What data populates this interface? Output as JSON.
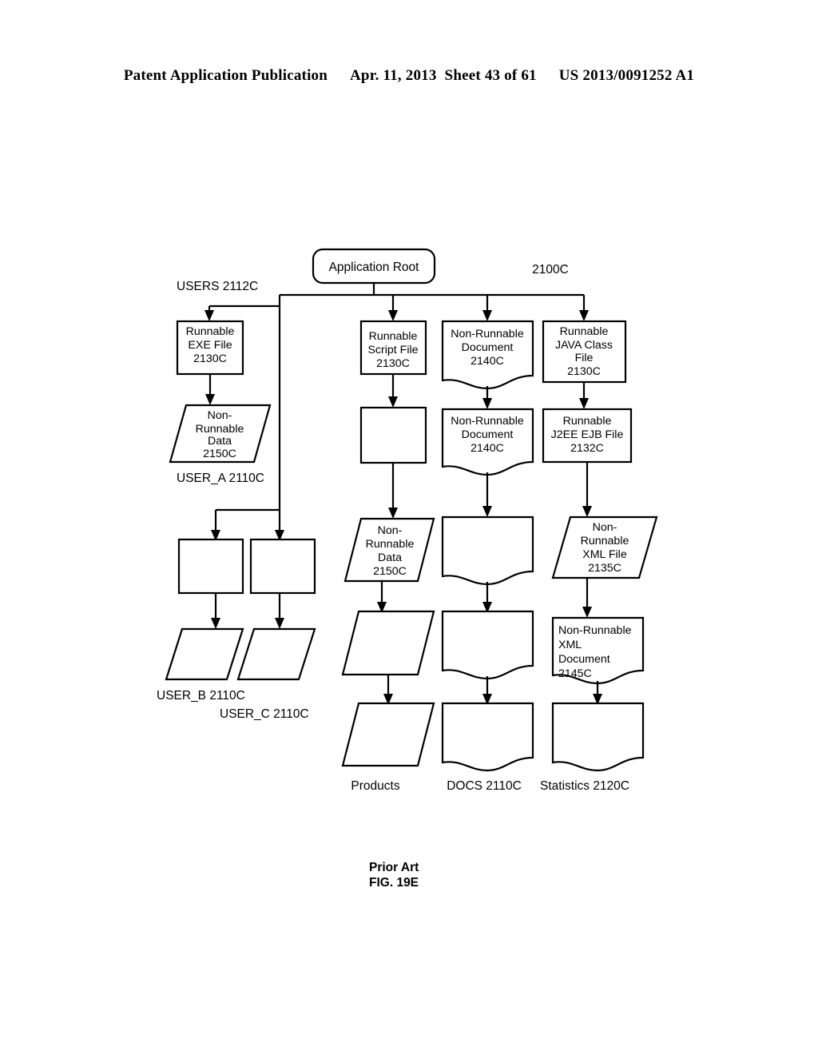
{
  "header": {
    "publication": "Patent Application Publication",
    "date": "Apr. 11, 2013",
    "sheet": "Sheet 43 of 61",
    "number": "US 2013/0091252 A1"
  },
  "caption": {
    "prior_art": "Prior Art",
    "figure": "FIG. 19E"
  },
  "diagram": {
    "root_label": "Application Root",
    "diagram_ref": "2100C",
    "users_label": "USERS 2112C",
    "user_a_label": "USER_A 2110C",
    "user_b_label": "USER_B 2110C",
    "user_c_label": "USER_C 2110C",
    "products_label": "Products",
    "docs_label": "DOCS 2110C",
    "statistics_label": "Statistics 2120C",
    "nodes": {
      "exe_file": {
        "lines": [
          "Runnable",
          "EXE File",
          "2130C"
        ],
        "shape": "rect"
      },
      "nonrunnable_data_a": {
        "lines": [
          "Non-",
          "Runnable",
          "Data",
          "2150C"
        ],
        "shape": "parallelogram"
      },
      "user_b_box": {
        "lines": [],
        "shape": "rect"
      },
      "user_c_box": {
        "lines": [],
        "shape": "rect"
      },
      "user_b_data": {
        "lines": [],
        "shape": "parallelogram"
      },
      "user_c_data": {
        "lines": [],
        "shape": "parallelogram"
      },
      "script_file": {
        "lines": [
          "Runnable",
          "Script File",
          "2130C"
        ],
        "shape": "rect"
      },
      "script_child_box": {
        "lines": [],
        "shape": "rect"
      },
      "script_data": {
        "lines": [
          "Non-",
          "Runnable",
          "Data",
          "2150C"
        ],
        "shape": "parallelogram"
      },
      "products_mid": {
        "lines": [],
        "shape": "parallelogram"
      },
      "products_bottom": {
        "lines": [],
        "shape": "parallelogram"
      },
      "document_top": {
        "lines": [
          "Non-Runnable",
          "Document",
          "2140C"
        ],
        "shape": "document"
      },
      "document_second": {
        "lines": [
          "Non-Runnable",
          "Document",
          "2140C"
        ],
        "shape": "document"
      },
      "document_third": {
        "lines": [],
        "shape": "document"
      },
      "document_fourth": {
        "lines": [],
        "shape": "document"
      },
      "document_bottom": {
        "lines": [],
        "shape": "document"
      },
      "java_class_file": {
        "lines": [
          "Runnable",
          "JAVA Class",
          "File",
          "2130C"
        ],
        "shape": "rect"
      },
      "j2ee_ejb_file": {
        "lines": [
          "Runnable",
          "J2EE EJB File",
          "2132C"
        ],
        "shape": "rect"
      },
      "xml_file": {
        "lines": [
          "Non-",
          "Runnable",
          "XML File",
          "2135C"
        ],
        "shape": "parallelogram"
      },
      "xml_document": {
        "lines": [
          "Non-Runnable",
          "XML",
          "Document",
          "2145C"
        ],
        "shape": "document",
        "align": "left"
      },
      "statistics_bottom": {
        "lines": [],
        "shape": "document"
      }
    }
  }
}
